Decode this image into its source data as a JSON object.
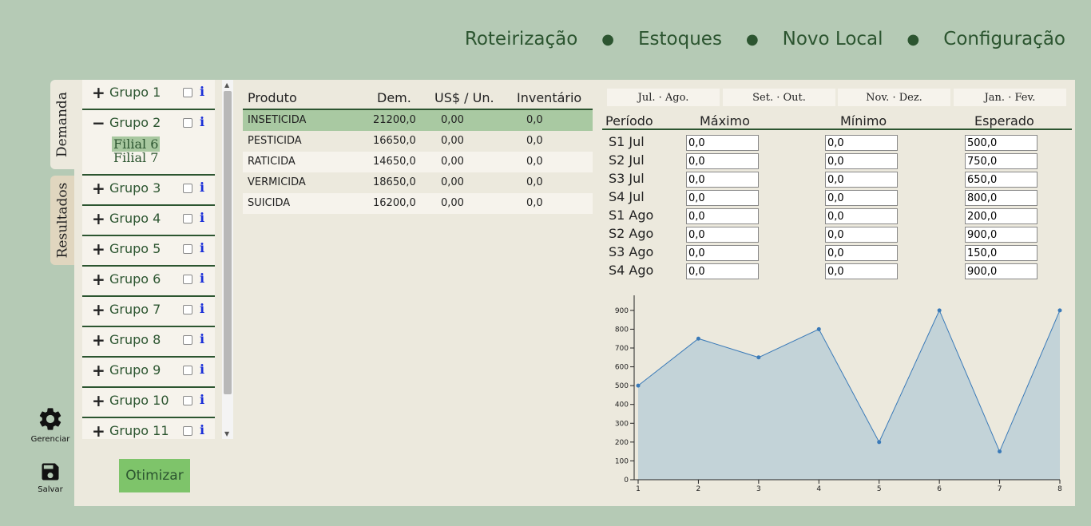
{
  "nav": {
    "items": [
      "Roteirização",
      "Estoques",
      "Novo Local",
      "Configuração"
    ]
  },
  "side_tabs": {
    "demanda": "Demanda",
    "resultados": "Resultados"
  },
  "groups": [
    {
      "sign": "+",
      "label": "Grupo 1"
    },
    {
      "sign": "−",
      "label": "Grupo 2",
      "filiais": [
        "Filial 6",
        "Filial 7"
      ],
      "selected_filial": "Filial 6"
    },
    {
      "sign": "+",
      "label": "Grupo 3"
    },
    {
      "sign": "+",
      "label": "Grupo 4"
    },
    {
      "sign": "+",
      "label": "Grupo 5"
    },
    {
      "sign": "+",
      "label": "Grupo 6"
    },
    {
      "sign": "+",
      "label": "Grupo 7"
    },
    {
      "sign": "+",
      "label": "Grupo 8"
    },
    {
      "sign": "+",
      "label": "Grupo 9"
    },
    {
      "sign": "+",
      "label": "Grupo 10"
    },
    {
      "sign": "+",
      "label": "Grupo 11"
    }
  ],
  "info_glyph": "i",
  "side_buttons": {
    "gerenciar": "Gerenciar",
    "salvar": "Salvar"
  },
  "optimize_label": "Otimizar",
  "products": {
    "headers": [
      "Produto",
      "Dem.",
      "US$ / Un.",
      "Inventário"
    ],
    "rows": [
      [
        "INSETICIDA",
        "21200,0",
        "0,00",
        "0,0"
      ],
      [
        "PESTICIDA",
        "16650,0",
        "0,00",
        "0,0"
      ],
      [
        "RATICIDA",
        "14650,0",
        "0,00",
        "0,0"
      ],
      [
        "VERMICIDA",
        "18650,0",
        "0,00",
        "0,0"
      ],
      [
        "SUICIDA",
        "16200,0",
        "0,00",
        "0,0"
      ]
    ],
    "selected_row": 0
  },
  "period_tabs": [
    "Jul. · Ago.",
    "Set. · Out.",
    "Nov. · Dez.",
    "Jan. · Fev."
  ],
  "period_table": {
    "headers": [
      "Período",
      "Máximo",
      "Mínimo",
      "Esperado"
    ],
    "rows": [
      [
        "S1 Jul",
        "0,0",
        "0,0",
        "500,0"
      ],
      [
        "S2 Jul",
        "0,0",
        "0,0",
        "750,0"
      ],
      [
        "S3 Jul",
        "0,0",
        "0,0",
        "650,0"
      ],
      [
        "S4 Jul",
        "0,0",
        "0,0",
        "800,0"
      ],
      [
        "S1 Ago",
        "0,0",
        "0,0",
        "200,0"
      ],
      [
        "S2 Ago",
        "0,0",
        "0,0",
        "900,0"
      ],
      [
        "S3 Ago",
        "0,0",
        "0,0",
        "150,0"
      ],
      [
        "S4 Ago",
        "0,0",
        "0,0",
        "900,0"
      ]
    ]
  },
  "chart_data": {
    "type": "area",
    "x": [
      1,
      2,
      3,
      4,
      5,
      6,
      7,
      8
    ],
    "values": [
      500,
      750,
      650,
      800,
      200,
      900,
      150,
      900
    ],
    "yticks": [
      0,
      100,
      200,
      300,
      400,
      500,
      600,
      700,
      800,
      900
    ],
    "xticks": [
      1,
      2,
      3,
      4,
      5,
      6,
      7,
      8
    ],
    "ylim": [
      0,
      980
    ],
    "xlim": [
      1,
      8
    ],
    "line_color": "#3a7ab8",
    "fill_color": "#c3d3d8"
  }
}
